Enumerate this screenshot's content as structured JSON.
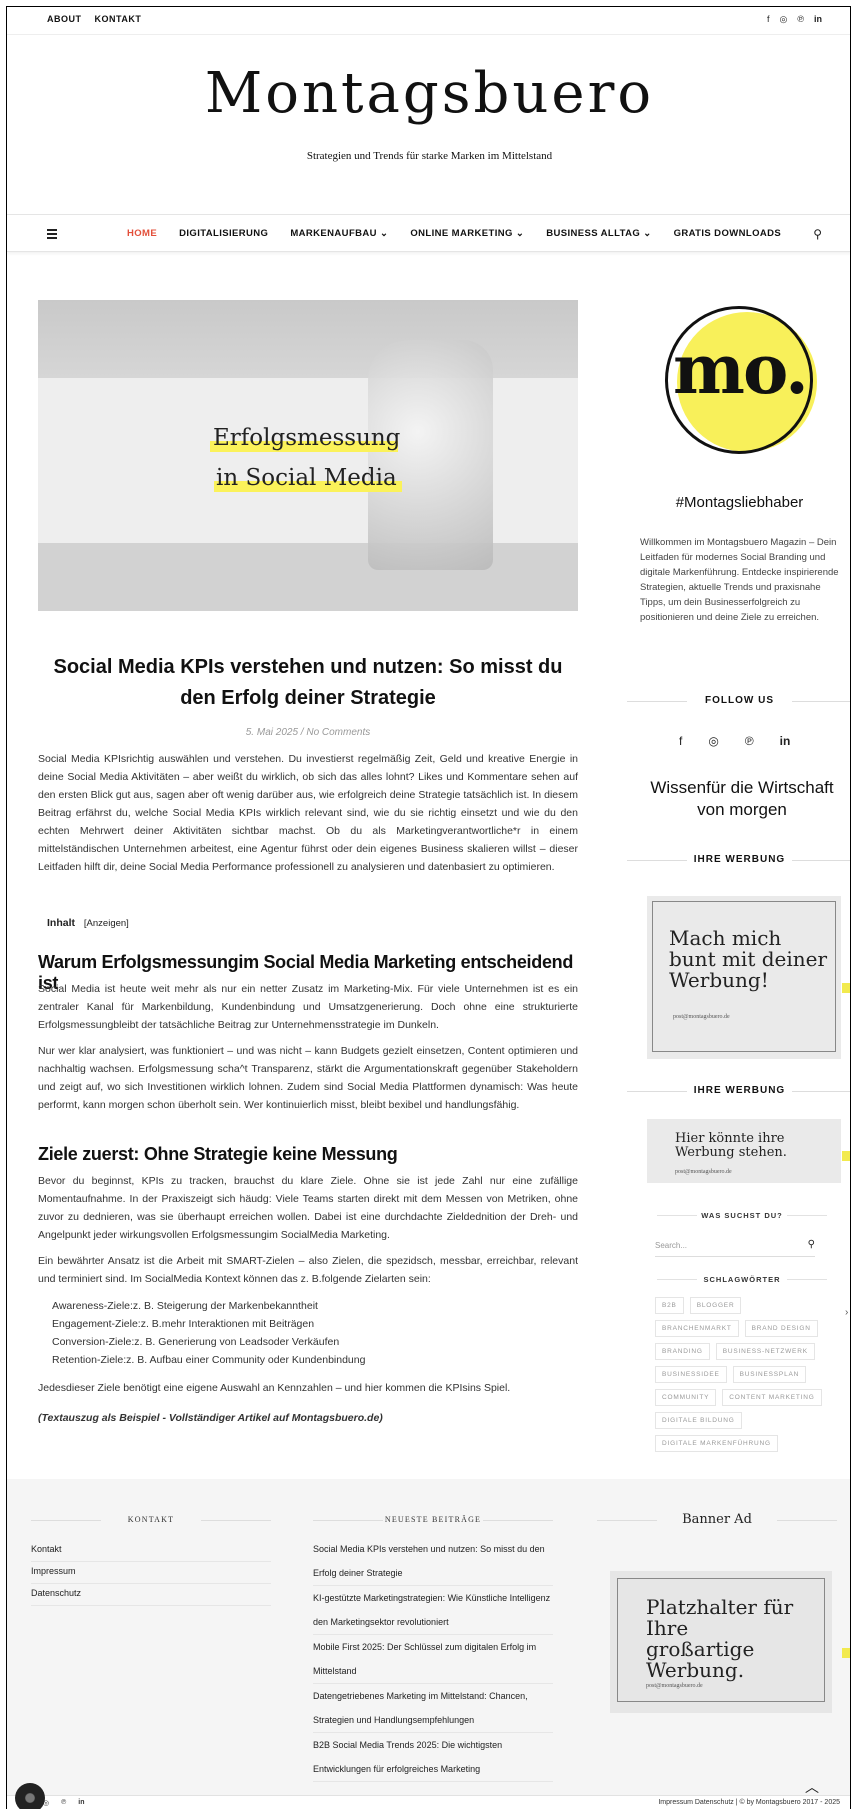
{
  "topbar": {
    "links": [
      "ABOUT",
      "KONTAKT"
    ],
    "social": [
      "f",
      "◎",
      "℗",
      "in"
    ]
  },
  "header": {
    "title": "Montagsbuero",
    "tagline": "Strategien und Trends für starke Marken im Mittelstand"
  },
  "nav": {
    "items": [
      "HOME",
      "DIGITALISIERUNG",
      "MARKENAUFBAU ⌄",
      "ONLINE MARKETING ⌄",
      "BUSINESS ALLTAG ⌄",
      "GRATIS DOWNLOADS"
    ],
    "active_color": "#e34f3a"
  },
  "hero": {
    "line1": "Erfolgsmessung",
    "line2": "in Social Media",
    "highlight_color": "#fbf25a"
  },
  "post": {
    "title": "Social Media KPIs verstehen und nutzen: So misst du den Erfolg deiner Strategie",
    "meta": "5. Mai 2025 / No Comments",
    "intro": "Social Media KPIsrichtig auswählen und verstehen. Du investierst regelmäßig Zeit, Geld und kreative Energie in deine Social Media Aktivitäten – aber weißt du wirklich, ob sich das alles lohnt? Likes und Kommentare sehen auf den ersten Blick gut aus, sagen aber oft wenig darüber aus, wie erfolgreich deine Strategie tatsächlich ist. In diesem Beitrag erfährst du, welche Social Media KPIs wirklich relevant sind, wie du sie richtig einsetzt und wie du den echten Mehrwert deiner Aktivitäten sichtbar machst. Ob du als Marketingverantwortliche*r in einem mittelständischen Unternehmen arbeitest, eine Agentur führst oder dein eigenes Business skalieren willst – dieser Leitfaden hilft dir, deine Social Media Performance professionell zu analysieren und datenbasiert zu optimieren.",
    "toc_label": "Inhalt",
    "toc_toggle": "[Anzeigen]",
    "h2_1": "Warum Erfolgsmessungim Social Media Marketing  entscheidend ist",
    "p2": "Social Media ist heute weit mehr als nur ein netter Zusatz im Marketing-Mix. Für viele Unternehmen ist es ein zentraler Kanal für Markenbildung, Kundenbindung und Umsatzgenerierung. Doch ohne eine strukturierte Erfolgsmessungbleibt der tatsächliche Beitrag zur Unternehmensstrategie im Dunkeln.",
    "p3": "Nur wer klar analysiert, was funktioniert – und was nicht – kann Budgets gezielt einsetzen, Content optimieren und nachhaltig wachsen. Erfolgsmessung scha^t Transparenz, stärkt die Argumentationskraft gegenüber Stakeholdern und zeigt auf, wo sich Investitionen wirklich lohnen. Zudem sind Social Media Plattformen dynamisch: Was heute performt, kann morgen schon überholt sein. Wer kontinuierlich misst, bleibt bexibel und handlungsfähig.",
    "h2_2": "Ziele zuerst: Ohne Strategie keine Messung",
    "p4": "Bevor du beginnst, KPIs zu tracken, brauchst du klare Ziele. Ohne sie ist jede Zahl nur eine zufällige Momentaufnahme. In der Praxiszeigt sich häudg: Viele Teams starten direkt mit dem Messen von Metriken, ohne zuvor zu dednieren, was sie überhaupt erreichen wollen. Dabei ist eine durchdachte Zieldednition der Dreh- und Angelpunkt jeder wirkungsvollen Erfolgsmessungim SocialMedia Marketing.",
    "p5": "Ein bewährter Ansatz ist die Arbeit mit SMART-Zielen – also Zielen, die spezidsch, messbar, erreichbar, relevant und terminiert sind. Im SocialMedia Kontext können das z. B.folgende Zielarten sein:",
    "list": [
      "Awareness-Ziele:z. B. Steigerung der Markenbekanntheit",
      "Engagement-Ziele:z. B.mehr Interaktionen mit Beiträgen",
      "Conversion-Ziele:z. B. Generierung von Leadsoder Verkäufen",
      "Retention-Ziele:z. B. Aufbau einer Community oder Kundenbindung"
    ],
    "p6": "Jedesdieser Ziele benötigt eine eigene Auswahl an Kennzahlen – und hier kommen die KPIsins Spiel.",
    "excerpt": "(Textauszug als Beispiel - Vollständiger Artikel auf Montagsbuero.de)"
  },
  "sidebar": {
    "logo_text": "mo.",
    "logo_color": "#f8f05a",
    "heading": "#Montagsliebhaber",
    "about": "Willkommen im Montagsbuero Magazin – Dein Leitfaden für modernes Social Branding und digitale Markenführung. Entdecke inspirierende Strategien, aktuelle Trends und praxisnahe Tipps, um dein Businesserfolgreich zu positionieren und deine Ziele zu erreichen.",
    "follow_label": "FOLLOW US",
    "social": [
      "f",
      "◎",
      "℗",
      "in"
    ],
    "wissen": "Wissenfür die Wirtschaft von morgen",
    "ad_label_1": "IHRE WERBUNG",
    "ad1_text": "Mach mich bunt mit deiner Werbung!",
    "ad1_mail": "post@montagsbuero.de",
    "ad_label_2": "IHRE WERBUNG",
    "ad2_text": "Hier könnte ihre Werbung stehen.",
    "ad2_mail": "post@montagsbuero.de",
    "search_label": "WAS SUCHST DU?",
    "search_placeholder": "Search...",
    "tags_label": "SCHLAGWÖRTER",
    "tags": [
      "B2B",
      "BLOGGER",
      "BRANCHENMARKT",
      "BRAND DESIGN",
      "BRANDING",
      "BUSINESS-NETZWERK",
      "BUSINESSIDEE",
      "BUSINESSPLAN",
      "COMMUNITY",
      "CONTENT MARKETING",
      "DIGITALE BILDUNG",
      "DIGITALE MARKENFÜHRUNG"
    ]
  },
  "footer": {
    "kontakt_label": "KONTAKT",
    "links": [
      "Kontakt",
      "Impressum",
      "Datenschutz"
    ],
    "posts_label": "NEUESTE BEITRÄGE",
    "posts": [
      "Social Media KPIs verstehen und nutzen: So misst du den Erfolg deiner Strategie",
      "KI-gestützte Marketingstrategien: Wie Künstliche Intelligenz den Marketingsektor revolutioniert",
      "Mobile First 2025: Der Schlüssel zum digitalen Erfolg im Mittelstand",
      "Datengetriebenes Marketing im Mittelstand: Chancen, Strategien und Handlungsempfehlungen",
      "B2B Social Media Trends 2025: Die wichtigsten Entwicklungen für erfolgreiches Marketing"
    ],
    "banner_label": "Banner Ad",
    "banner_text": "Platzhalter für Ihre großartige Werbung.",
    "banner_mail": "post@montagsbuero.de",
    "to_top": "︿",
    "bottom_social": [
      "◎",
      "℗",
      "in"
    ],
    "copyright": "Impressum  Datenschutz  |  © by Montagsbuero 2017 - 2025"
  }
}
